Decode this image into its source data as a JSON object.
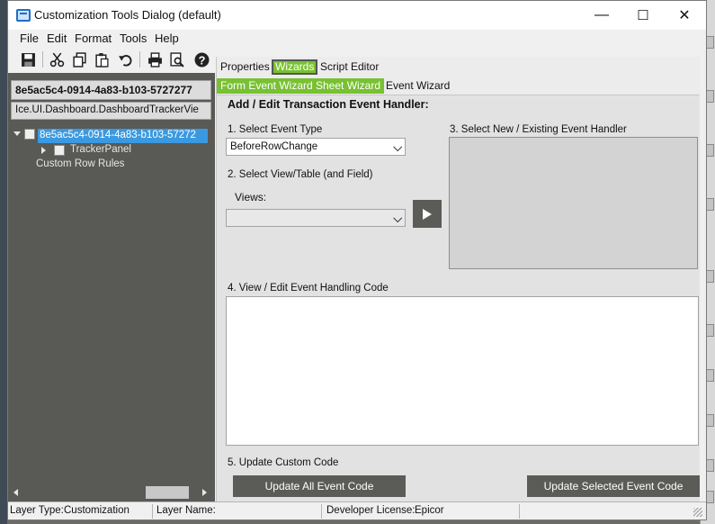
{
  "window": {
    "title": "Customization Tools Dialog (default)",
    "minimize_glyph": "—",
    "maximize_glyph": "☐",
    "close_glyph": "✕"
  },
  "menu": [
    "File",
    "Edit",
    "Format",
    "Tools",
    "Help"
  ],
  "toolbar": {
    "icons": [
      "save-icon",
      "cut-icon",
      "copy-icon",
      "paste-icon",
      "undo-icon",
      "print-icon",
      "print-preview-icon",
      "help-icon"
    ]
  },
  "left_panel": {
    "node_title": "8e5ac5c4-0914-4a83-b103-5727277",
    "node_class": "Ice.UI.Dashboard.DashboardTrackerVie",
    "tree": {
      "root": "8e5ac5c4-0914-4a83-b103-57272",
      "child": "TrackerPanel",
      "extra": "Custom Row Rules"
    }
  },
  "tabs": {
    "top": [
      "Properties",
      "Wizards",
      "Script Editor"
    ],
    "active_top": "Wizards",
    "sub": [
      "Form Event Wizard",
      "Sheet Wizard",
      "Event Wizard"
    ]
  },
  "wizard": {
    "heading": "Add / Edit Transaction Event Handler:",
    "step1_label": "1. Select Event Type",
    "event_type_value": "BeforeRowChange",
    "step2_label": "2. Select View/Table (and Field)",
    "views_label": "Views:",
    "views_value": "",
    "step3_label": "3. Select New / Existing Event Handler",
    "step4_label": "4. View / Edit Event Handling Code",
    "step5_label": "5. Update Custom Code",
    "update_all_label": "Update All Event Code",
    "update_selected_label": "Update Selected Event Code"
  },
  "status": {
    "layer_type_label": "Layer Type:",
    "layer_type_value": "Customization",
    "layer_name_label": "Layer Name:",
    "layer_name_value": "",
    "license_label": "Developer License:",
    "license_value": "Epicor"
  },
  "colors": {
    "accent_green": "#78c132",
    "panel_dark": "#595955",
    "selection_blue": "#3a99e0"
  }
}
